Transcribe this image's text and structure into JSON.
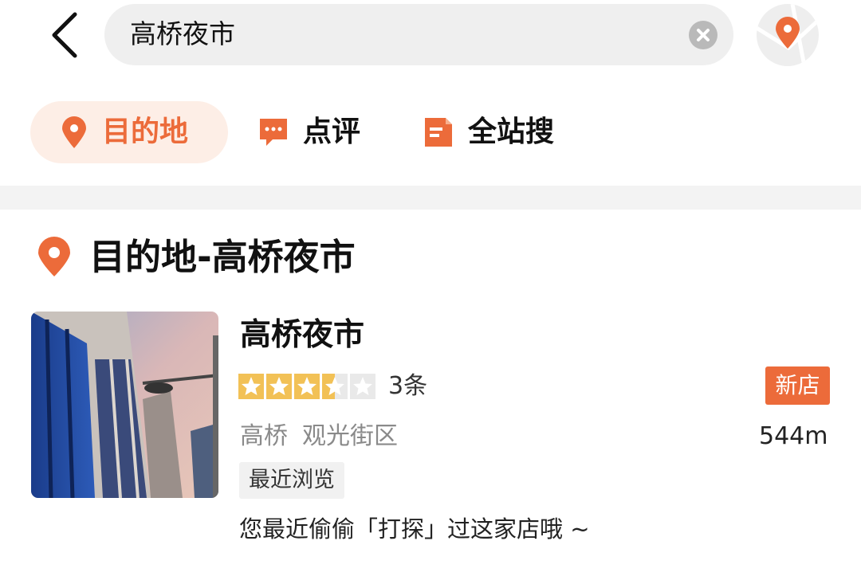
{
  "search": {
    "query": "高桥夜市"
  },
  "icons": {
    "back": "chevron-left-icon",
    "clear": "close-circle-icon",
    "map": "map-pin-icon",
    "destination": "location-pin-icon",
    "review": "comment-icon",
    "site_search": "document-icon"
  },
  "tabs": [
    {
      "label": "目的地",
      "active": true
    },
    {
      "label": "点评",
      "active": false
    },
    {
      "label": "全站搜",
      "active": false
    }
  ],
  "section": {
    "title": "目的地-高桥夜市"
  },
  "result": {
    "name": "高桥夜市",
    "rating": 3.5,
    "rating_max": 5,
    "review_count": "3条",
    "badge": "新店",
    "area": "高桥",
    "category": "观光街区",
    "distance": "544m",
    "tag": "最近浏览",
    "note": "您最近偷偷「打探」过这家店哦 ~"
  },
  "colors": {
    "accent": "#ec6b3a",
    "star": "#f2c156",
    "star_empty": "#e9e9e9",
    "tab_active_bg": "#fdeee6"
  }
}
